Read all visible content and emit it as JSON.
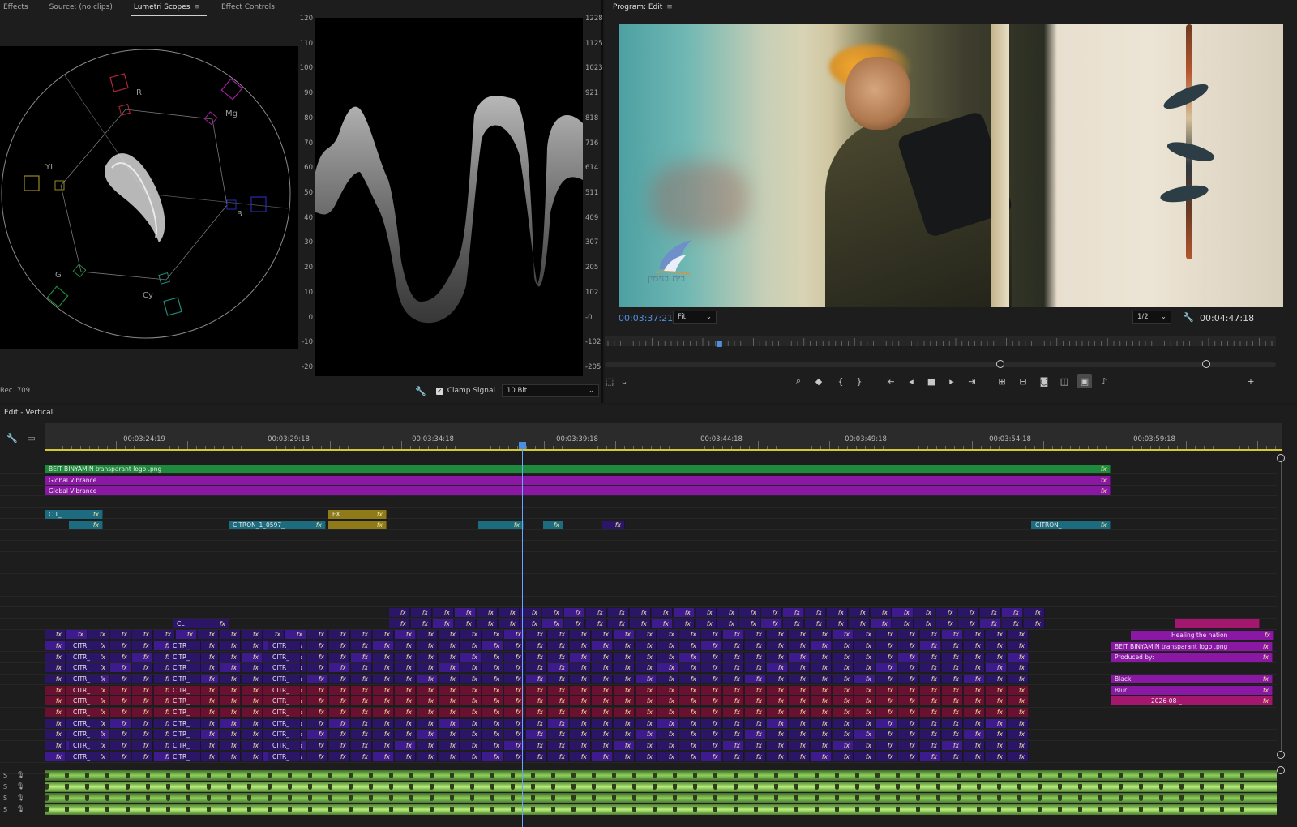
{
  "tabs": [
    {
      "label": "Effects"
    },
    {
      "label": "Source: (no clips)"
    },
    {
      "label": "Lumetri Scopes",
      "active": true
    },
    {
      "label": "Effect Controls"
    }
  ],
  "vectorscope": {
    "labels": [
      "R",
      "Mg",
      "YI",
      "B",
      "G",
      "Cy"
    ]
  },
  "waveform": {
    "left_scale": [
      "120",
      "110",
      "100",
      "90",
      "80",
      "70",
      "60",
      "50",
      "40",
      "30",
      "20",
      "10",
      "0",
      "-10",
      "-20"
    ],
    "right_scale": [
      "1228",
      "1125",
      "1023",
      "921",
      "818",
      "716",
      "614",
      "511",
      "409",
      "307",
      "205",
      "102",
      "-0",
      "-102",
      "-205"
    ]
  },
  "scope_footer": {
    "colorspace": "Rec. 709",
    "clamp_label": "Clamp Signal",
    "bit_depth": "10 Bit"
  },
  "program": {
    "title": "Program: Edit",
    "timecode": "00:03:37:21",
    "fit": "Fit",
    "quality": "1/2",
    "duration": "00:04:47:18",
    "logo_text": "בית בנימין",
    "playhead_fraction": 0.17
  },
  "icons": {
    "menu": "hamburger-icon",
    "wrench": "wrench-icon",
    "chevron": "chevron-down-icon",
    "add": "plus-icon",
    "volume": "speaker-icon"
  },
  "timeline": {
    "title": "Edit - Vertical",
    "ruler_labels": [
      "00:03:24:19",
      "00:03:29:18",
      "00:03:34:18",
      "00:03:39:18",
      "00:03:44:18",
      "00:03:49:18",
      "00:03:54:18",
      "00:03:59:18"
    ],
    "fx_label": "fx",
    "top_clips": [
      {
        "label": "BEIT BINYAMIN transparant logo .png"
      },
      {
        "label": "Global Vibrance"
      },
      {
        "label": "Global Vibrance"
      }
    ],
    "v_clips": [
      {
        "label": "CIT_"
      },
      {
        "label": "CITRON_1_0597_"
      },
      {
        "label": "FX"
      },
      {
        "label": "CITRON_"
      },
      {
        "label": "CL"
      },
      {
        "label": "CITR_"
      }
    ],
    "right_clips": [
      {
        "label": "Healing the nation"
      },
      {
        "label": "BEIT BINYAMIN transparant logo .png"
      },
      {
        "label": "Produced by:"
      },
      {
        "label": "Black"
      },
      {
        "label": "Blur"
      },
      {
        "label": "2026-08-_"
      }
    ],
    "audio_tracks": [
      "S",
      "S",
      "S",
      "S"
    ]
  }
}
